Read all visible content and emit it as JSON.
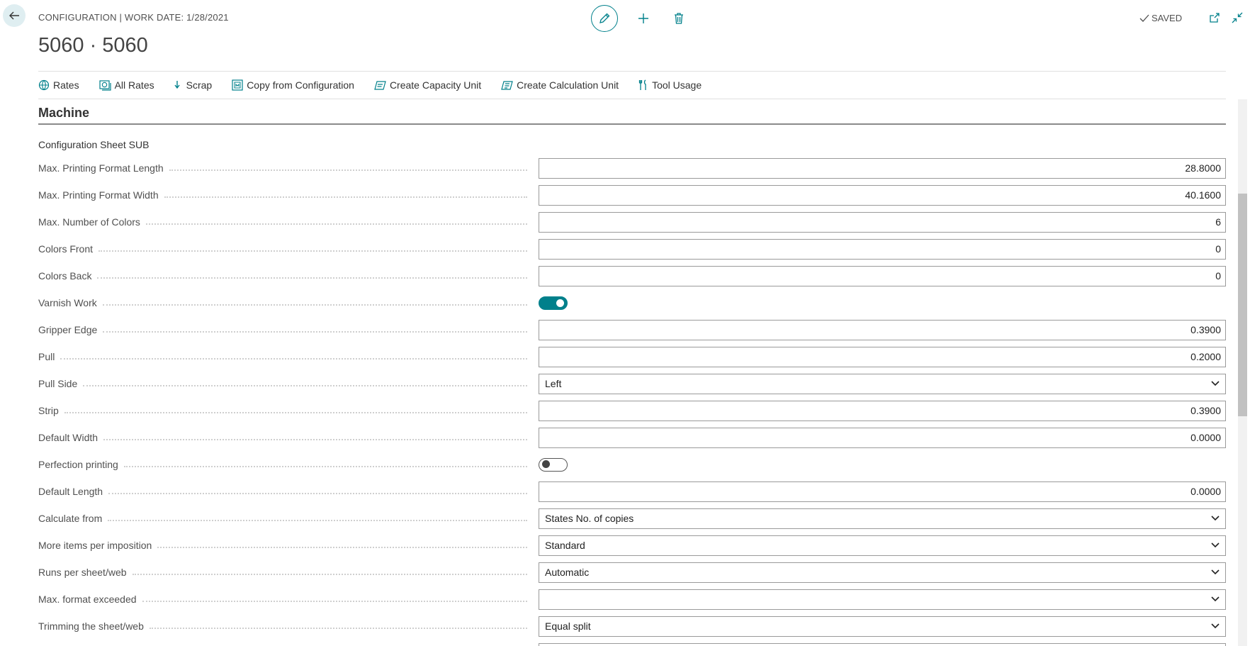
{
  "header": {
    "breadcrumb": "CONFIGURATION | WORK DATE: 1/28/2021",
    "title": "5060 · 5060",
    "status": "SAVED"
  },
  "actions": [
    {
      "label": "Rates",
      "icon": "globe-icon"
    },
    {
      "label": "All Rates",
      "icon": "all-rates-icon"
    },
    {
      "label": "Scrap",
      "icon": "scrap-arrow-icon"
    },
    {
      "label": "Copy from Configuration",
      "icon": "copy-config-icon"
    },
    {
      "label": "Create Capacity Unit",
      "icon": "capacity-unit-icon"
    },
    {
      "label": "Create Calculation Unit",
      "icon": "calculation-unit-icon"
    },
    {
      "label": "Tool Usage",
      "icon": "tools-icon"
    }
  ],
  "section": {
    "title": "Machine",
    "group": "Configuration Sheet SUB"
  },
  "fields": [
    {
      "label": "Max. Printing Format Length",
      "type": "number",
      "value": "28.8000"
    },
    {
      "label": "Max. Printing Format Width",
      "type": "number",
      "value": "40.1600"
    },
    {
      "label": "Max. Number of Colors",
      "type": "number",
      "value": "6"
    },
    {
      "label": "Colors Front",
      "type": "number",
      "value": "0"
    },
    {
      "label": "Colors Back",
      "type": "number",
      "value": "0"
    },
    {
      "label": "Varnish Work",
      "type": "toggle",
      "value": true
    },
    {
      "label": "Gripper Edge",
      "type": "number",
      "value": "0.3900"
    },
    {
      "label": "Pull",
      "type": "number",
      "value": "0.2000"
    },
    {
      "label": "Pull Side",
      "type": "select",
      "value": "Left"
    },
    {
      "label": "Strip",
      "type": "number",
      "value": "0.3900"
    },
    {
      "label": "Default Width",
      "type": "number",
      "value": "0.0000"
    },
    {
      "label": "Perfection printing",
      "type": "toggle",
      "value": false
    },
    {
      "label": "Default Length",
      "type": "number",
      "value": "0.0000"
    },
    {
      "label": "Calculate from",
      "type": "select",
      "value": "States No. of copies"
    },
    {
      "label": "More items per imposition",
      "type": "select",
      "value": "Standard"
    },
    {
      "label": "Runs per sheet/web",
      "type": "select",
      "value": "Automatic"
    },
    {
      "label": "Max. format exceeded",
      "type": "select",
      "value": ""
    },
    {
      "label": "Trimming the sheet/web",
      "type": "select",
      "value": "Equal split"
    }
  ],
  "colors": {
    "accent": "#00808b",
    "accent_light": "#dfeef1"
  }
}
